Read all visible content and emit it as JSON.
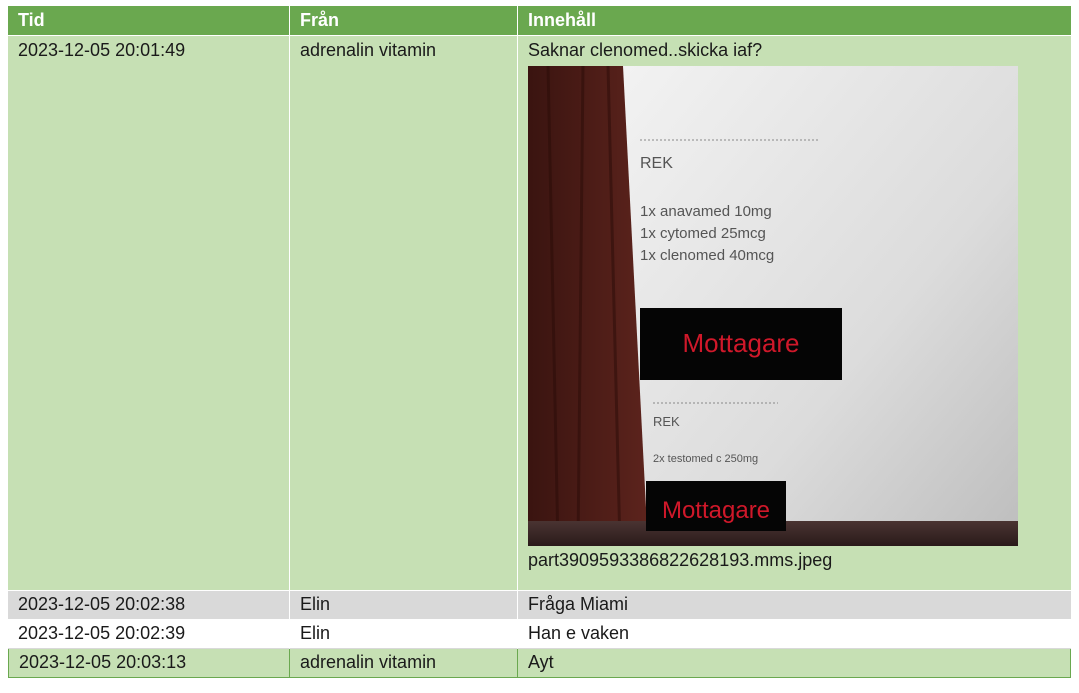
{
  "headers": {
    "time": "Tid",
    "from": "Från",
    "content": "Innehåll"
  },
  "rows": [
    {
      "time": "2023-12-05 20:01:49",
      "from": "adrenalin vitamin",
      "content": "Saknar clenomed..skicka iaf?",
      "attachment": {
        "filename": "part3909593386822628193.mms.jpeg",
        "label1": "REK",
        "items": [
          "1x anavamed 10mg",
          "1x cytomed 25mcg",
          "1x clenomed 40mcg"
        ],
        "recipient1": "Mottagare",
        "label2": "REK",
        "item2": "2x testomed c 250mg",
        "recipient2": "Mottagare"
      }
    },
    {
      "time": "2023-12-05 20:02:38",
      "from": "Elin",
      "content": "Fråga Miami"
    },
    {
      "time": "2023-12-05 20:02:39",
      "from": "Elin",
      "content": "Han e vaken"
    },
    {
      "time": "2023-12-05 20:03:13",
      "from": "adrenalin vitamin",
      "content": "Ayt"
    }
  ],
  "colors": {
    "header": "#6aa84f",
    "row_green": "#c6e0b4",
    "row_gray": "#d9d9d9",
    "row_white": "#ffffff"
  }
}
